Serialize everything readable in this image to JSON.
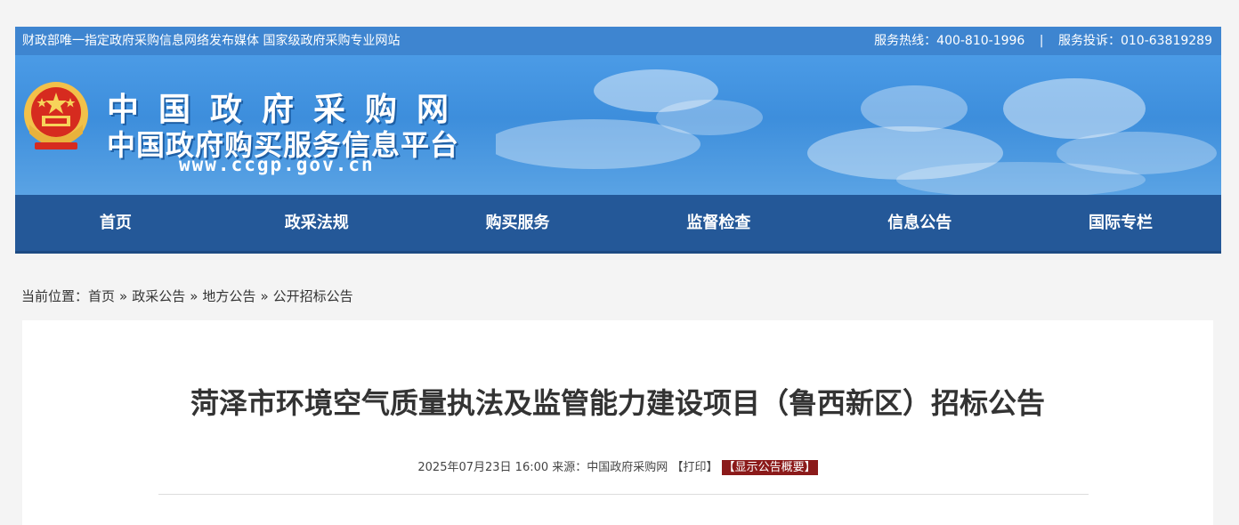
{
  "topbar": {
    "left_text": "财政部唯一指定政府采购信息网络发布媒体 国家级政府采购专业网站",
    "hotline": "服务热线：400-810-1996",
    "separator": "|",
    "complaint": "服务投诉：010-63819289"
  },
  "banner": {
    "title": "中国政府采购网",
    "subtitle": "中国政府购买服务信息平台",
    "url": "www.ccgp.gov.cn",
    "emblem_icon": "national-emblem-icon"
  },
  "nav": {
    "items": [
      {
        "label": "首页"
      },
      {
        "label": "政采法规"
      },
      {
        "label": "购买服务"
      },
      {
        "label": "监督检查"
      },
      {
        "label": "信息公告"
      },
      {
        "label": "国际专栏"
      }
    ]
  },
  "breadcrumb": {
    "prefix": "当前位置：",
    "items": [
      "首页",
      "政采公告",
      "地方公告",
      "公开招标公告"
    ],
    "arrow": "»"
  },
  "article": {
    "title": "菏泽市环境空气质量执法及监管能力建设项目（鲁西新区）招标公告",
    "date": "2025年07月23日 16:00",
    "source_label": "来源：",
    "source": "中国政府采购网",
    "print_label": "【打印】",
    "summary_label": "【显示公告概要】"
  },
  "colors": {
    "topbar": "#3e85d0",
    "nav": "#245898",
    "summary_badge": "#8b1a1a"
  }
}
